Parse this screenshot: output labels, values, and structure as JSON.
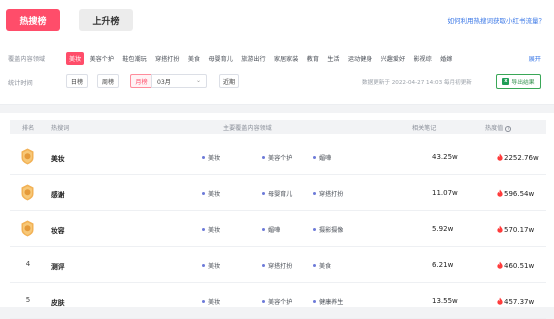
{
  "tabs": [
    {
      "label": "热搜榜",
      "active": true
    },
    {
      "label": "上升榜",
      "active": false
    }
  ],
  "help_link": "如何利用热搜词获取小红书流量？",
  "filters": {
    "domain_label": "覆盖内容领域",
    "domain_chips": [
      {
        "label": "美妆",
        "active": true
      },
      {
        "label": "美容个护",
        "active": false
      },
      {
        "label": "鞋包潮玩",
        "active": false
      },
      {
        "label": "穿搭打扮",
        "active": false
      },
      {
        "label": "美食",
        "active": false
      },
      {
        "label": "母婴育儿",
        "active": false
      },
      {
        "label": "旅游出行",
        "active": false
      },
      {
        "label": "家居家装",
        "active": false
      },
      {
        "label": "教育",
        "active": false
      },
      {
        "label": "生活",
        "active": false
      },
      {
        "label": "运动健身",
        "active": false
      },
      {
        "label": "兴趣爱好",
        "active": false
      },
      {
        "label": "影视综",
        "active": false
      },
      {
        "label": "婚嫁",
        "active": false
      }
    ],
    "expand_label": "展开",
    "time_label": "统计时间",
    "time_buttons": {
      "day": "日榜",
      "week": "周榜",
      "month": "月榜",
      "recent": "近期"
    },
    "month_value": "03月",
    "update_info": "数据更新于 2022-04-27 14:03   每月初更新",
    "export_label": "导出结果"
  },
  "table": {
    "headers": {
      "rank": "排名",
      "word": "热搜词",
      "domain": "主要覆盖内容领域",
      "notes": "相关笔记",
      "heat": "热度值"
    },
    "rows": [
      {
        "rank": "1",
        "word": "美妆",
        "tags": [
          "美妆",
          "美容个护",
          "媚嘩"
        ],
        "notes": "43.25w",
        "heat": "2252.76w"
      },
      {
        "rank": "2",
        "word": "感谢",
        "tags": [
          "美妆",
          "母婴育儿",
          "穿搭打扮"
        ],
        "notes": "11.07w",
        "heat": "596.54w"
      },
      {
        "rank": "3",
        "word": "妆容",
        "tags": [
          "美妆",
          "媚嘩",
          "摄影摄像"
        ],
        "notes": "5.92w",
        "heat": "570.17w"
      },
      {
        "rank": "4",
        "word": "测评",
        "tags": [
          "美妆",
          "穿搭打扮",
          "美食"
        ],
        "notes": "6.21w",
        "heat": "460.51w"
      },
      {
        "rank": "5",
        "word": "皮肤",
        "tags": [
          "美妆",
          "美容个护",
          "健康养生"
        ],
        "notes": "13.55w",
        "heat": "457.37w"
      }
    ]
  },
  "colors": {
    "accent": "#ff4d6a",
    "link": "#3b78e7",
    "export_green": "#2f8f4a",
    "medal_gold": "#f2b155",
    "fire": "#ff3b3b"
  },
  "icons": {
    "chevron": "chevron-down-icon",
    "info": "info-icon",
    "excel": "excel-icon",
    "fire": "fire-icon",
    "medal": "medal-icon"
  }
}
